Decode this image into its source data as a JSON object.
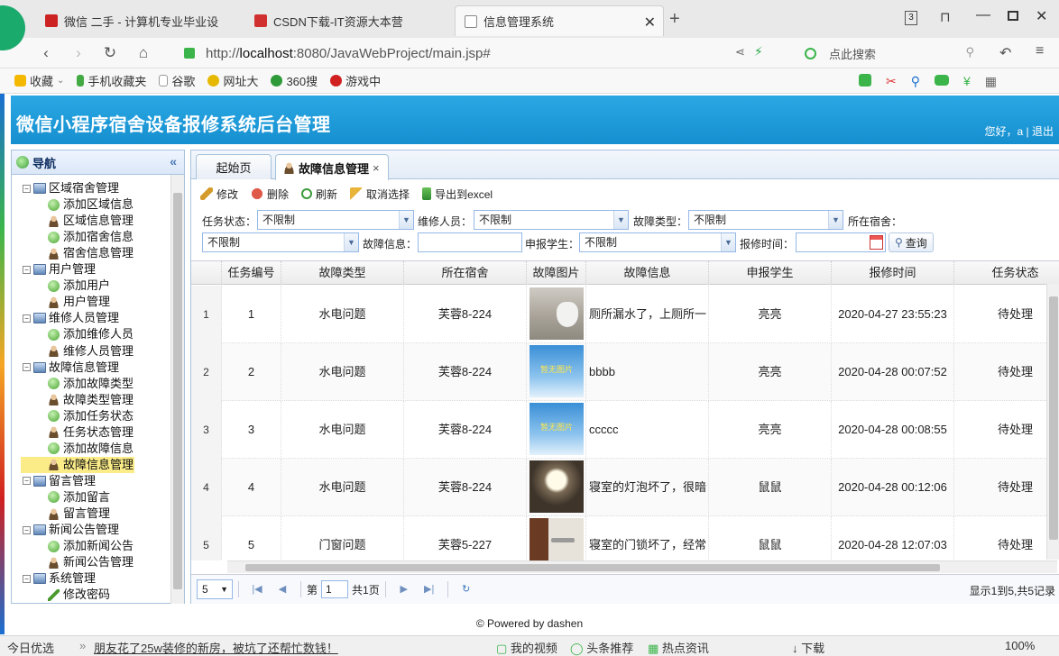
{
  "browser": {
    "tabs": [
      {
        "title": "微信 二手 - 计算机专业毕业设",
        "color": "#cc2222"
      },
      {
        "title": "CSDN下载-IT资源大本营",
        "color": "#d03030"
      },
      {
        "title": "信息管理系统",
        "color": "#888888",
        "active": true
      }
    ],
    "url_prefix": "http://",
    "url_host": "localhost",
    "url_rest": ":8080/JavaWebProject/main.jsp#",
    "search_placeholder": "点此搜索",
    "window_badge": "3",
    "bookmarks": [
      "收藏",
      "手机收藏夹",
      "谷歌",
      "网址大",
      "360搜",
      "游戏中"
    ]
  },
  "app": {
    "title": "微信小程序宿舍设备报修系统后台管理",
    "greeting": "您好，a",
    "logout": "退出",
    "nav_title": "导航"
  },
  "tree": [
    {
      "label": "区域宿舍管理",
      "type": "group"
    },
    {
      "label": "添加区域信息",
      "type": "add"
    },
    {
      "label": "区域信息管理",
      "type": "user"
    },
    {
      "label": "添加宿舍信息",
      "type": "add"
    },
    {
      "label": "宿舍信息管理",
      "type": "user"
    },
    {
      "label": "用户管理",
      "type": "group"
    },
    {
      "label": "添加用户",
      "type": "add"
    },
    {
      "label": "用户管理",
      "type": "user"
    },
    {
      "label": "维修人员管理",
      "type": "group"
    },
    {
      "label": "添加维修人员",
      "type": "add"
    },
    {
      "label": "维修人员管理",
      "type": "user"
    },
    {
      "label": "故障信息管理",
      "type": "group"
    },
    {
      "label": "添加故障类型",
      "type": "add"
    },
    {
      "label": "故障类型管理",
      "type": "user"
    },
    {
      "label": "添加任务状态",
      "type": "add"
    },
    {
      "label": "任务状态管理",
      "type": "user"
    },
    {
      "label": "添加故障信息",
      "type": "add"
    },
    {
      "label": "故障信息管理",
      "type": "user",
      "selected": true
    },
    {
      "label": "留言管理",
      "type": "group"
    },
    {
      "label": "添加留言",
      "type": "add"
    },
    {
      "label": "留言管理",
      "type": "user"
    },
    {
      "label": "新闻公告管理",
      "type": "group"
    },
    {
      "label": "添加新闻公告",
      "type": "add"
    },
    {
      "label": "新闻公告管理",
      "type": "user"
    },
    {
      "label": "系统管理",
      "type": "group"
    },
    {
      "label": "修改密码",
      "type": "pen"
    }
  ],
  "panel_tabs": [
    "起始页",
    "故障信息管理"
  ],
  "toolbar": {
    "edit": "修改",
    "delete": "删除",
    "refresh": "刷新",
    "deselect": "取消选择",
    "export": "导出到excel"
  },
  "filters": {
    "task_status_label": "任务状态：",
    "task_status": "不限制",
    "repairer_label": "维修人员：",
    "repairer": "不限制",
    "fault_type_label": "故障类型：",
    "fault_type": "不限制",
    "dorm_label": "所在宿舍：",
    "dorm": "不限制",
    "fault_info_label": "故障信息：",
    "fault_info": "",
    "student_label": "申报学生：",
    "student": "不限制",
    "time_label": "报修时间：",
    "time": "",
    "query": "查询"
  },
  "table": {
    "columns": [
      "任务编号",
      "故障类型",
      "所在宿舍",
      "故障图片",
      "故障信息",
      "申报学生",
      "报修时间",
      "任务状态"
    ],
    "rows": [
      {
        "no": "1",
        "id": "1",
        "type": "水电问题",
        "dorm": "芙蓉8-224",
        "img": "toilet",
        "info": "厕所漏水了，上厕所一",
        "student": "亮亮",
        "time": "2020-04-27 23:55:23",
        "status": "待处理"
      },
      {
        "no": "2",
        "id": "2",
        "type": "水电问题",
        "dorm": "芙蓉8-224",
        "img": "none",
        "img_text": "暂无图片",
        "info": "bbbb",
        "student": "亮亮",
        "time": "2020-04-28 00:07:52",
        "status": "待处理"
      },
      {
        "no": "3",
        "id": "3",
        "type": "水电问题",
        "dorm": "芙蓉8-224",
        "img": "none",
        "img_text": "暂无图片",
        "info": "ccccc",
        "student": "亮亮",
        "time": "2020-04-28 00:08:55",
        "status": "待处理"
      },
      {
        "no": "4",
        "id": "4",
        "type": "水电问题",
        "dorm": "芙蓉8-224",
        "img": "lamp",
        "info": "寝室的灯泡坏了，很暗",
        "student": "鼠鼠",
        "time": "2020-04-28 00:12:06",
        "status": "待处理"
      },
      {
        "no": "5",
        "id": "5",
        "type": "门窗问题",
        "dorm": "芙蓉5-227",
        "img": "door",
        "info": "寝室的门锁坏了，经常",
        "student": "鼠鼠",
        "time": "2020-04-28 12:07:03",
        "status": "待处理"
      }
    ]
  },
  "pager": {
    "page_size": "5",
    "page_label": "第",
    "page": "1",
    "total_pages": "共1页",
    "summary": "显示1到5,共5记录"
  },
  "footer": "© Powered by dashen",
  "statusbar": {
    "left": "今日优选",
    "news": "朋友花了25w装修的新房，被坑了还帮忙数钱！",
    "video": "我的视频",
    "recommend": "头条推荐",
    "hot": "热点资讯",
    "download": "下载",
    "zoom": "100%"
  }
}
